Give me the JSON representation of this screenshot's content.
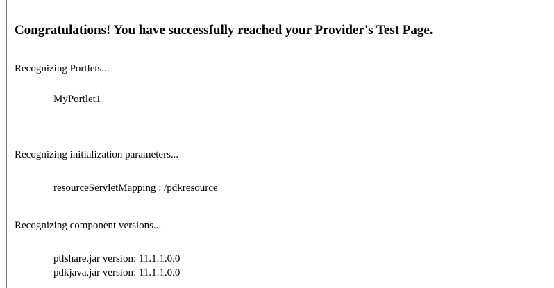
{
  "page": {
    "heading": "Congratulations! You have successfully reached your Provider's Test Page."
  },
  "sections": {
    "portlets": {
      "label": "Recognizing Portlets...",
      "items": [
        "MyPortlet1"
      ]
    },
    "init_params": {
      "label": "Recognizing initialization parameters...",
      "items": [
        "resourceServletMapping : /pdkresource"
      ]
    },
    "versions": {
      "label": "Recognizing component versions...",
      "items": [
        "ptlshare.jar version: 11.1.1.0.0",
        "pdkjava.jar version: 11.1.1.0.0"
      ]
    }
  }
}
